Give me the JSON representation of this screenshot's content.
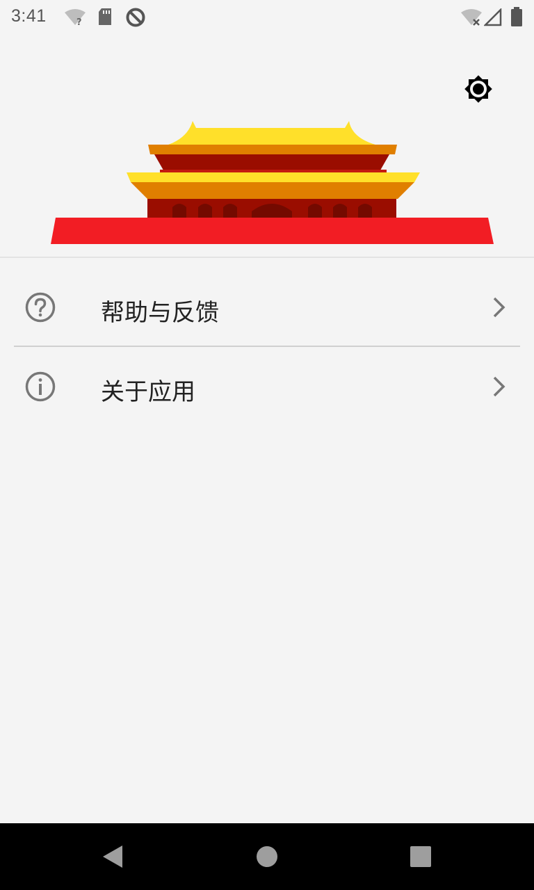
{
  "status_bar": {
    "time": "3:41",
    "icons": [
      "wifi-unknown-icon",
      "sd-card-icon",
      "data-saver-icon",
      "wifi-off-icon",
      "cell-signal-icon",
      "battery-icon"
    ]
  },
  "header": {
    "brightness_icon": "brightness-icon",
    "illustration": "tiananmen-gate-illustration",
    "colors": {
      "roof": "#ffe02a",
      "eave": "#e07f00",
      "wall": "#9a0d00",
      "platform": "#f21d24"
    }
  },
  "menu": {
    "items": [
      {
        "label": "帮助与反馈",
        "icon": "help-circle-icon"
      },
      {
        "label": "关于应用",
        "icon": "info-circle-icon"
      }
    ]
  },
  "nav_bar": {
    "buttons": [
      "back-icon",
      "home-icon",
      "recents-icon"
    ]
  }
}
